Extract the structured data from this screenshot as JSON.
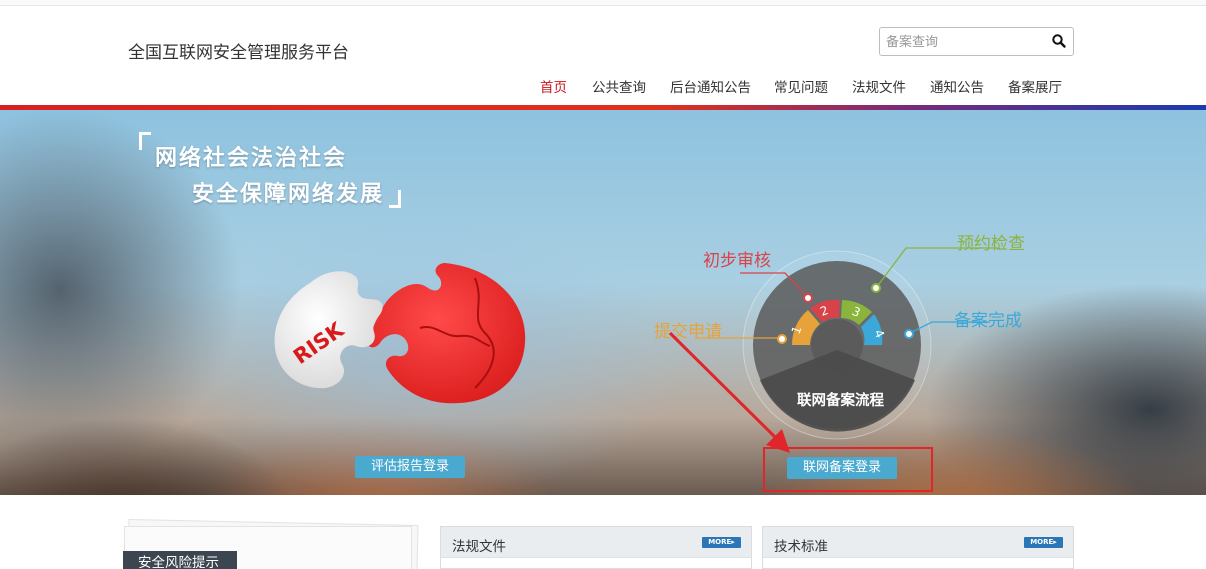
{
  "header": {
    "site_title": "全国互联网安全管理服务平台",
    "search": {
      "placeholder": "备案查询",
      "icon": "search-icon"
    }
  },
  "nav": {
    "items": [
      {
        "label": "首页",
        "active": true
      },
      {
        "label": "公共查询"
      },
      {
        "label": "后台通知公告"
      },
      {
        "label": "常见问题"
      },
      {
        "label": "法规文件"
      },
      {
        "label": "通知公告"
      },
      {
        "label": "备案展厅"
      }
    ]
  },
  "banner": {
    "slogan_line1": "网络社会法治社会",
    "slogan_line2": "安全保障网络发展",
    "risk_text": "RISK",
    "eval_login_label": "评估报告登录",
    "record_login_label": "联网备案登录",
    "process": {
      "center_label": "联网备案流程",
      "steps": [
        {
          "num": "1",
          "label": "提交申请",
          "color": "#e8a23a"
        },
        {
          "num": "2",
          "label": "初步审核",
          "color": "#d8434a"
        },
        {
          "num": "3",
          "label": "预约检查",
          "color": "#8ab43c"
        },
        {
          "num": "4",
          "label": "备案完成",
          "color": "#3aa8d8"
        }
      ]
    }
  },
  "content": {
    "risk_tab_label": "安全风险提示",
    "cards": [
      {
        "title": "法规文件",
        "more_label": "MORE"
      },
      {
        "title": "技术标准",
        "more_label": "MORE"
      }
    ]
  },
  "colors": {
    "brand_red": "#c8161d",
    "accent_blue": "#4aa9cf",
    "annotation_red": "#e0262b"
  }
}
